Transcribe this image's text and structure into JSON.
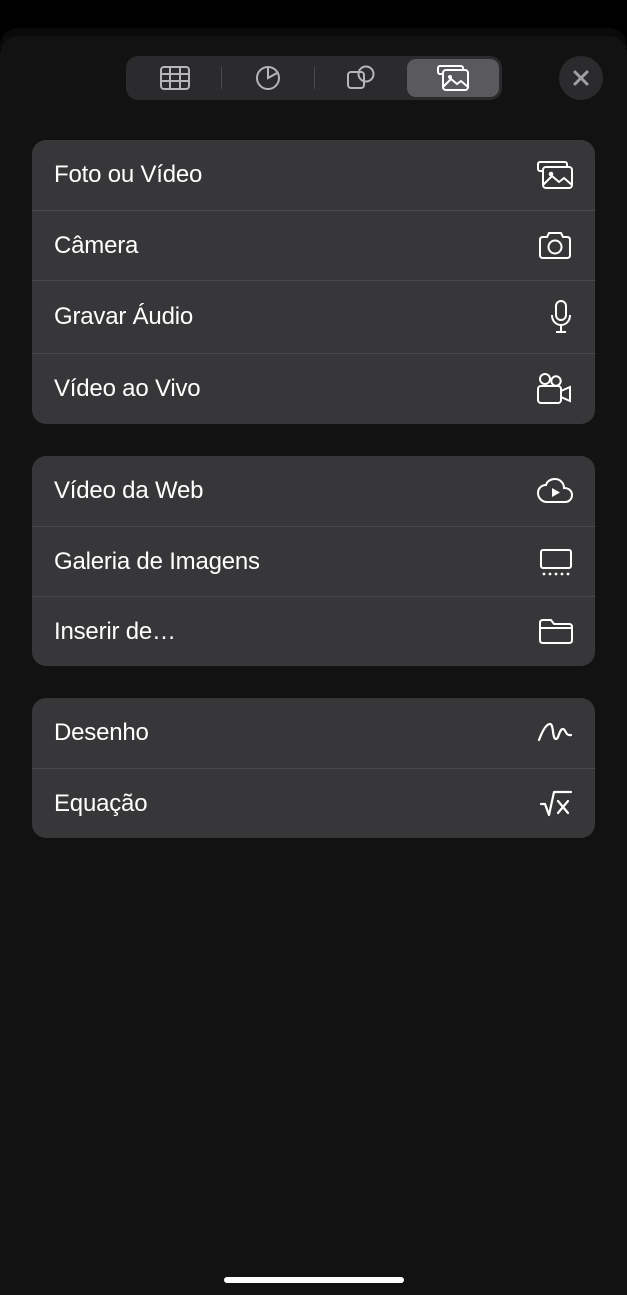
{
  "tabs": {
    "table": "table",
    "chart": "chart",
    "shapes": "shapes",
    "media": "media"
  },
  "groups": [
    {
      "items": [
        {
          "label": "Foto ou Vídeo",
          "icon": "photo"
        },
        {
          "label": "Câmera",
          "icon": "camera"
        },
        {
          "label": "Gravar Áudio",
          "icon": "microphone"
        },
        {
          "label": "Vídeo ao Vivo",
          "icon": "video-camera"
        }
      ]
    },
    {
      "items": [
        {
          "label": "Vídeo da Web",
          "icon": "cloud-play"
        },
        {
          "label": "Galeria de Imagens",
          "icon": "gallery"
        },
        {
          "label": "Inserir de…",
          "icon": "folder"
        }
      ]
    },
    {
      "items": [
        {
          "label": "Desenho",
          "icon": "scribble"
        },
        {
          "label": "Equação",
          "icon": "equation"
        }
      ]
    }
  ]
}
